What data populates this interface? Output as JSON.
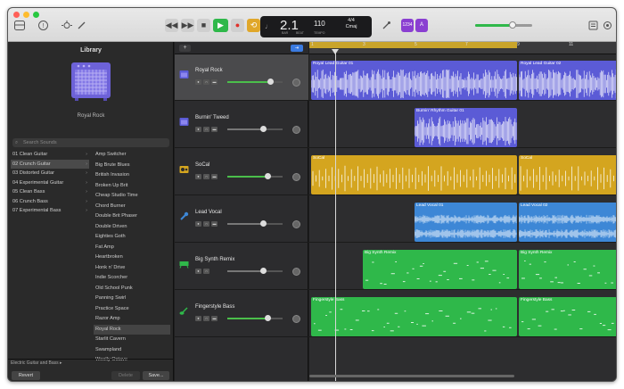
{
  "transport": {
    "bars": "2.1",
    "bar_label": "BAR",
    "beat_label": "BEAT",
    "tempo": "110",
    "tempo_label": "TEMPO",
    "time_sig": "4/4",
    "key": "Cmaj",
    "count_in": "1234",
    "metronome": "A"
  },
  "library": {
    "title": "Library",
    "preset_name": "Royal Rock",
    "search_placeholder": "Search Sounds",
    "categories": [
      {
        "label": "01 Clean Guitar"
      },
      {
        "label": "02 Crunch Guitar"
      },
      {
        "label": "03 Distorted Guitar"
      },
      {
        "label": "04 Experimental Guitar"
      },
      {
        "label": "05 Clean Bass"
      },
      {
        "label": "06 Crunch Bass"
      },
      {
        "label": "07 Experimental Bass"
      }
    ],
    "presets": [
      {
        "label": "Amp Switcher"
      },
      {
        "label": "Big Brute Blues"
      },
      {
        "label": "British Invasion"
      },
      {
        "label": "Broken Up Brit"
      },
      {
        "label": "Cheap Studio Time"
      },
      {
        "label": "Chord Burner"
      },
      {
        "label": "Double Brit Phaser"
      },
      {
        "label": "Double Driven"
      },
      {
        "label": "Eighties Goth"
      },
      {
        "label": "Fat Amp"
      },
      {
        "label": "Heartbroken"
      },
      {
        "label": "Honk n' Drive"
      },
      {
        "label": "Indie Scorcher"
      },
      {
        "label": "Old School Punk"
      },
      {
        "label": "Panning Swirl"
      },
      {
        "label": "Practice Space"
      },
      {
        "label": "Razor Amp"
      },
      {
        "label": "Royal Rock"
      },
      {
        "label": "Starlit Cavern"
      },
      {
        "label": "Swampland"
      },
      {
        "label": "Woolly Octave"
      }
    ],
    "footer_label": "Electric Guitar and Bass",
    "revert": "Revert",
    "delete": "Delete",
    "save": "Save..."
  },
  "tracks": [
    {
      "name": "Royal Rock",
      "color": "#5b5bd6"
    },
    {
      "name": "Burnin' Tweed",
      "color": "#5b5bd6"
    },
    {
      "name": "SoCal",
      "color": "#d4a51f"
    },
    {
      "name": "Lead Vocal",
      "color": "#3d87d6"
    },
    {
      "name": "Big Synth Remix",
      "color": "#2fb84a"
    },
    {
      "name": "Fingerstyle Bass",
      "color": "#2fb84a"
    }
  ],
  "regions": [
    {
      "label": "Royal Lead Guitar 01"
    },
    {
      "label": "Royal Lead Guitar 02"
    },
    {
      "label": "Burnin' Rhythm Guitar 01"
    },
    {
      "label": "SoCal"
    },
    {
      "label": "SoCal"
    },
    {
      "label": "Lead Vocal 01"
    },
    {
      "label": "Lead Vocal 02"
    },
    {
      "label": "Big Synth Remix"
    },
    {
      "label": "Big Synth Remix"
    },
    {
      "label": "Fingerstyle Bass"
    },
    {
      "label": "Fingerstyle Bass"
    }
  ],
  "ruler": [
    "1",
    "3",
    "5",
    "7",
    "9",
    "11"
  ],
  "colors": {
    "accent": "#2fb84a",
    "cycle": "#c9a42a",
    "selection": "#3b7be0"
  }
}
